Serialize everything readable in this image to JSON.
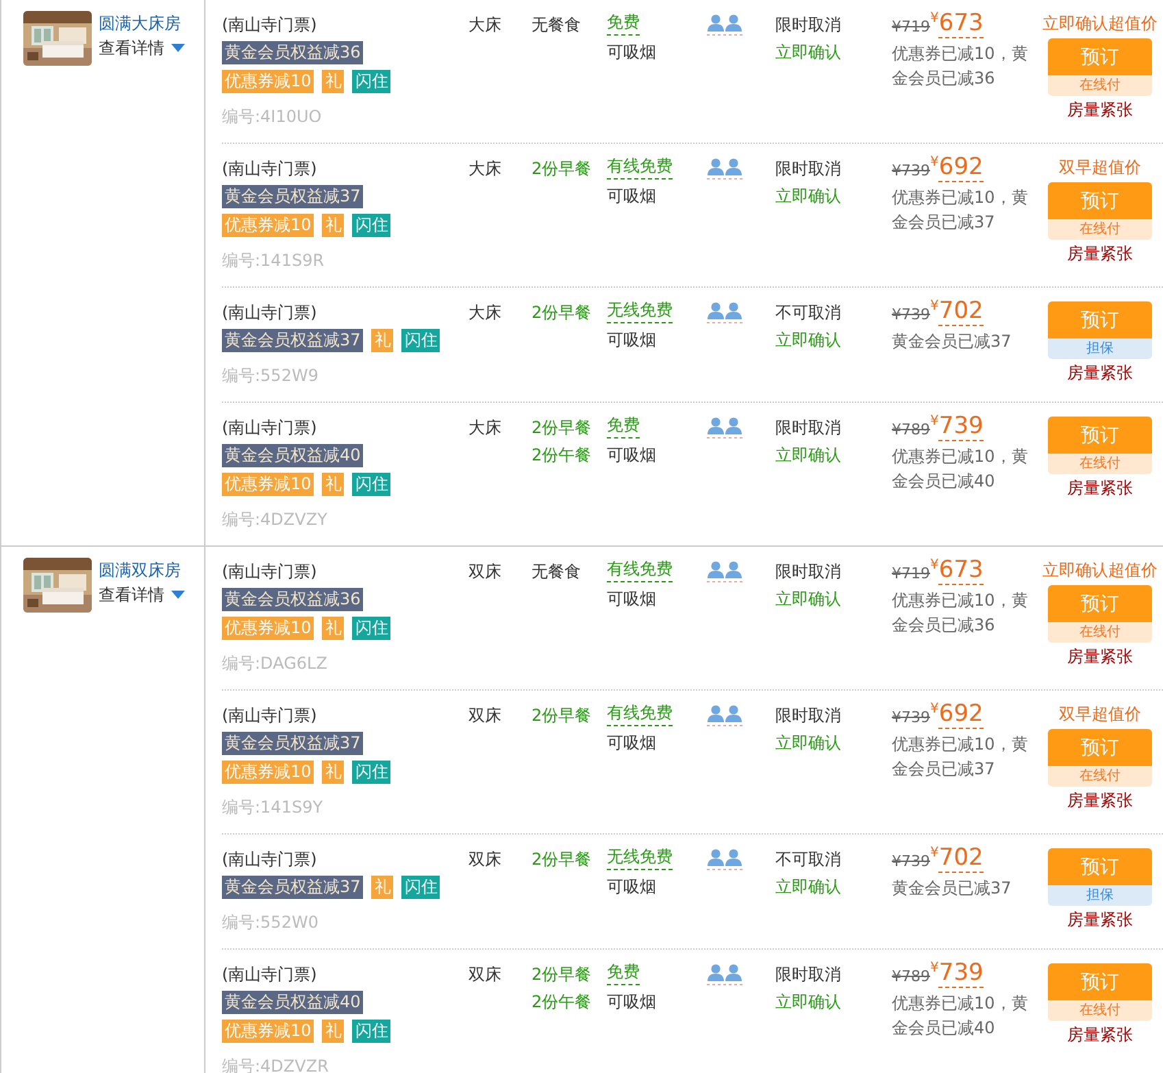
{
  "rooms": [
    {
      "name": "圆满大床房",
      "details_link": "查看详情",
      "rates": [
        {
          "package": "(南山寺门票)",
          "tag_lines": [
            [
              {
                "text": "黄金会员权益减36",
                "kind": "member"
              }
            ],
            [
              {
                "text": "优惠券减10",
                "kind": "coupon"
              },
              {
                "text": "礼",
                "kind": "gift"
              },
              {
                "text": "闪住",
                "kind": "flash"
              }
            ]
          ],
          "code": "编号:4I10UO",
          "bed": "大床",
          "meals": [
            "无餐食"
          ],
          "meal_included": false,
          "broadband": "免费",
          "smoking": "可吸烟",
          "cancel": "限时取消",
          "confirm": "立即确认",
          "original_price": "¥719",
          "currency": "¥",
          "price": "673",
          "discount_note": "优惠券已减10，黄金会员已减36",
          "promo": "立即确认超值价",
          "button": "预订",
          "pay": {
            "label": "在线付",
            "kind": "online"
          },
          "availability": "房量紧张"
        },
        {
          "package": "(南山寺门票)",
          "tag_lines": [
            [
              {
                "text": "黄金会员权益减37",
                "kind": "member"
              }
            ],
            [
              {
                "text": "优惠券减10",
                "kind": "coupon"
              },
              {
                "text": "礼",
                "kind": "gift"
              },
              {
                "text": "闪住",
                "kind": "flash"
              }
            ]
          ],
          "code": "编号:141S9R",
          "bed": "大床",
          "meals": [
            "2份早餐"
          ],
          "meal_included": true,
          "broadband": "有线免费",
          "smoking": "可吸烟",
          "cancel": "限时取消",
          "confirm": "立即确认",
          "original_price": "¥739",
          "currency": "¥",
          "price": "692",
          "discount_note": "优惠券已减10，黄金会员已减37",
          "promo": "双早超值价",
          "button": "预订",
          "pay": {
            "label": "在线付",
            "kind": "online"
          },
          "availability": "房量紧张"
        },
        {
          "package": "(南山寺门票)",
          "tag_lines": [
            [
              {
                "text": "黄金会员权益减37",
                "kind": "member"
              },
              {
                "text": "礼",
                "kind": "gift"
              },
              {
                "text": "闪住",
                "kind": "flash"
              }
            ]
          ],
          "code": "编号:552W9",
          "bed": "大床",
          "meals": [
            "2份早餐"
          ],
          "meal_included": true,
          "broadband": "无线免费",
          "smoking": "可吸烟",
          "cancel": "不可取消",
          "confirm": "立即确认",
          "original_price": "¥739",
          "currency": "¥",
          "price": "702",
          "discount_note": "黄金会员已减37",
          "button": "预订",
          "pay": {
            "label": "担保",
            "kind": "guarantee"
          },
          "availability": "房量紧张"
        },
        {
          "package": "(南山寺门票)",
          "tag_lines": [
            [
              {
                "text": "黄金会员权益减40",
                "kind": "member"
              }
            ],
            [
              {
                "text": "优惠券减10",
                "kind": "coupon"
              },
              {
                "text": "礼",
                "kind": "gift"
              },
              {
                "text": "闪住",
                "kind": "flash"
              }
            ]
          ],
          "code": "编号:4DZVZY",
          "bed": "大床",
          "meals": [
            "2份早餐",
            "2份午餐"
          ],
          "meal_included": true,
          "broadband": "免费",
          "smoking": "可吸烟",
          "cancel": "限时取消",
          "confirm": "立即确认",
          "original_price": "¥789",
          "currency": "¥",
          "price": "739",
          "discount_note": "优惠券已减10，黄金会员已减40",
          "button": "预订",
          "pay": {
            "label": "在线付",
            "kind": "online"
          },
          "availability": "房量紧张"
        }
      ]
    },
    {
      "name": "圆满双床房",
      "details_link": "查看详情",
      "rates": [
        {
          "package": "(南山寺门票)",
          "tag_lines": [
            [
              {
                "text": "黄金会员权益减36",
                "kind": "member"
              }
            ],
            [
              {
                "text": "优惠券减10",
                "kind": "coupon"
              },
              {
                "text": "礼",
                "kind": "gift"
              },
              {
                "text": "闪住",
                "kind": "flash"
              }
            ]
          ],
          "code": "编号:DAG6LZ",
          "bed": "双床",
          "meals": [
            "无餐食"
          ],
          "meal_included": false,
          "broadband": "有线免费",
          "smoking": "可吸烟",
          "cancel": "限时取消",
          "confirm": "立即确认",
          "original_price": "¥719",
          "currency": "¥",
          "price": "673",
          "discount_note": "优惠券已减10，黄金会员已减36",
          "promo": "立即确认超值价",
          "button": "预订",
          "pay": {
            "label": "在线付",
            "kind": "online"
          },
          "availability": "房量紧张"
        },
        {
          "package": "(南山寺门票)",
          "tag_lines": [
            [
              {
                "text": "黄金会员权益减37",
                "kind": "member"
              }
            ],
            [
              {
                "text": "优惠券减10",
                "kind": "coupon"
              },
              {
                "text": "礼",
                "kind": "gift"
              },
              {
                "text": "闪住",
                "kind": "flash"
              }
            ]
          ],
          "code": "编号:141S9Y",
          "bed": "双床",
          "meals": [
            "2份早餐"
          ],
          "meal_included": true,
          "broadband": "有线免费",
          "smoking": "可吸烟",
          "cancel": "限时取消",
          "confirm": "立即确认",
          "original_price": "¥739",
          "currency": "¥",
          "price": "692",
          "discount_note": "优惠券已减10，黄金会员已减37",
          "promo": "双早超值价",
          "button": "预订",
          "pay": {
            "label": "在线付",
            "kind": "online"
          },
          "availability": "房量紧张"
        },
        {
          "package": "(南山寺门票)",
          "tag_lines": [
            [
              {
                "text": "黄金会员权益减37",
                "kind": "member"
              },
              {
                "text": "礼",
                "kind": "gift"
              },
              {
                "text": "闪住",
                "kind": "flash"
              }
            ]
          ],
          "code": "编号:552W0",
          "bed": "双床",
          "meals": [
            "2份早餐"
          ],
          "meal_included": true,
          "broadband": "无线免费",
          "smoking": "可吸烟",
          "cancel": "不可取消",
          "confirm": "立即确认",
          "original_price": "¥739",
          "currency": "¥",
          "price": "702",
          "discount_note": "黄金会员已减37",
          "button": "预订",
          "pay": {
            "label": "担保",
            "kind": "guarantee"
          },
          "availability": "房量紧张"
        },
        {
          "package": "(南山寺门票)",
          "tag_lines": [
            [
              {
                "text": "黄金会员权益减40",
                "kind": "member"
              }
            ],
            [
              {
                "text": "优惠券减10",
                "kind": "coupon"
              },
              {
                "text": "礼",
                "kind": "gift"
              },
              {
                "text": "闪住",
                "kind": "flash"
              }
            ]
          ],
          "code": "编号:4DZVZR",
          "bed": "双床",
          "meals": [
            "2份早餐",
            "2份午餐"
          ],
          "meal_included": true,
          "broadband": "免费",
          "smoking": "可吸烟",
          "cancel": "限时取消",
          "confirm": "立即确认",
          "original_price": "¥789",
          "currency": "¥",
          "price": "739",
          "discount_note": "优惠券已减10，黄金会员已减40",
          "button": "预订",
          "pay": {
            "label": "在线付",
            "kind": "online"
          },
          "availability": "房量紧张"
        }
      ]
    }
  ]
}
